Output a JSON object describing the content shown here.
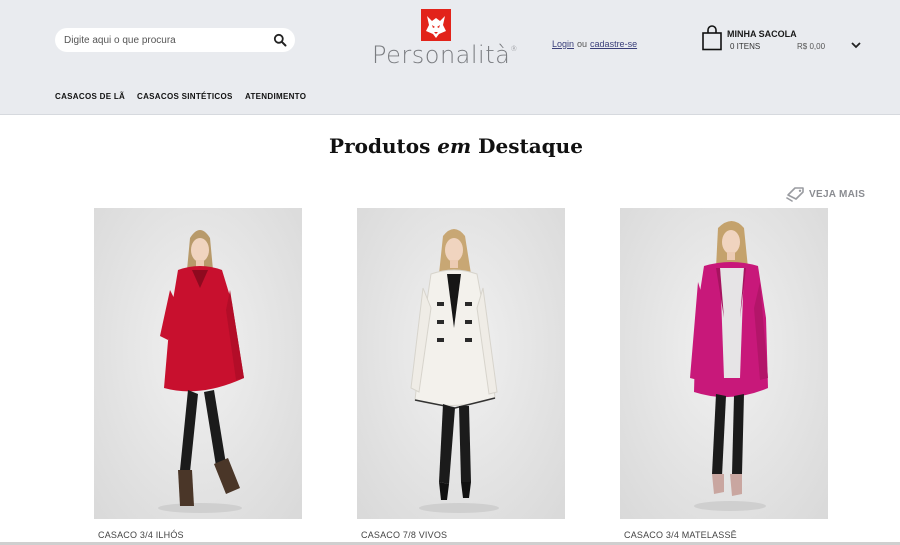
{
  "header": {
    "search": {
      "placeholder": "Digite aqui o que procura",
      "icon": "search-icon"
    },
    "logo": {
      "text": "Personalità",
      "mark_icon": "fox-logo-icon",
      "mark_color": "#e2231a"
    },
    "auth": {
      "login_label": "Login",
      "or_label": "ou",
      "signup_label": "cadastre-se"
    },
    "bag": {
      "title": "MINHA SACOLA",
      "count": "0 ITENS",
      "total": "R$ 0,00",
      "icon": "shopping-bag-icon",
      "toggle_icon": "chevron-down-icon"
    }
  },
  "nav": {
    "items": [
      {
        "label": "CASACOS DE LÃ"
      },
      {
        "label": "CASACOS SINTÉTICOS"
      },
      {
        "label": "ATENDIMENTO"
      }
    ]
  },
  "featured": {
    "title_before": "Produtos",
    "title_em": "em",
    "title_after": "Destaque",
    "see_more_label": "VEJA MAIS",
    "see_more_icon": "tag-icon",
    "products": [
      {
        "name": "CASACO 3/4 ILHÓS",
        "coat_color": "#c8102e"
      },
      {
        "name": "CASACO 7/8 VIVOS",
        "coat_color": "#f3f1ec"
      },
      {
        "name": "CASACO 3/4 MATELASSÊ",
        "coat_color": "#c8187a"
      }
    ]
  },
  "colors": {
    "header_bg": "#e9ebef",
    "link": "#3a3f7a",
    "muted": "#8a8c91"
  }
}
